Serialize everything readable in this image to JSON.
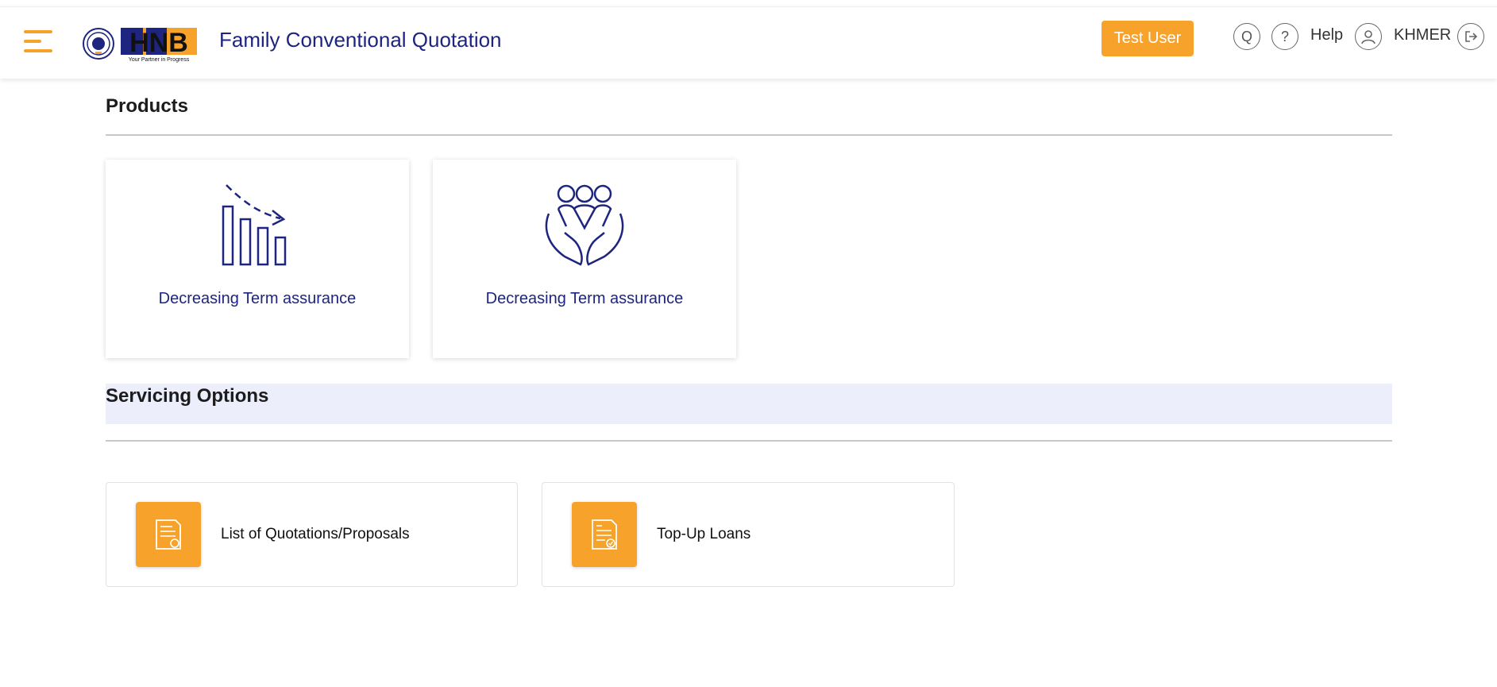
{
  "header": {
    "app_title": "Family Conventional Quotation",
    "logo_text": "HNB",
    "logo_tagline": "Your Partner in Progress",
    "user_button_label": "Test User",
    "q_icon_label": "Q",
    "help_icon_glyph": "?",
    "help_label": "Help",
    "language_label": "KHMER"
  },
  "products": {
    "section_title": "Products",
    "items": [
      {
        "label": "Decreasing Term assurance",
        "icon": "decreasing-bar-chart-icon"
      },
      {
        "label": "Decreasing Term assurance",
        "icon": "family-care-hands-icon"
      }
    ]
  },
  "servicing": {
    "section_title": "Servicing Options",
    "items": [
      {
        "label": "List of Quotations/Proposals",
        "icon": "document-list-icon"
      },
      {
        "label": "Top-Up Loans",
        "icon": "document-check-icon"
      }
    ]
  },
  "colors": {
    "accent": "#f7a32b",
    "brand_navy": "#1d2580",
    "band_bg": "#eceefb"
  }
}
